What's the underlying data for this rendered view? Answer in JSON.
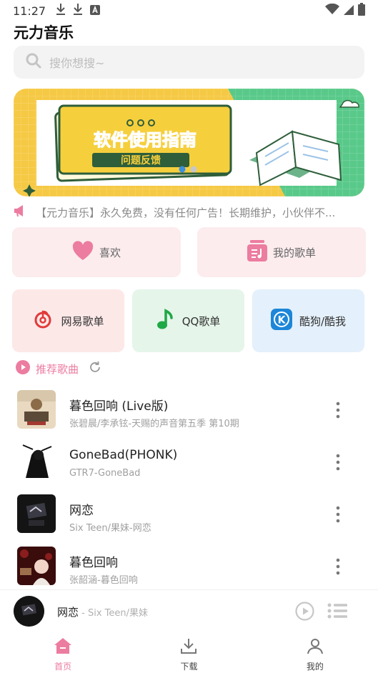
{
  "status": {
    "time": "11:27"
  },
  "app": {
    "title": "元力音乐"
  },
  "search": {
    "placeholder": "搜你想搜~"
  },
  "banner": {
    "title": "软件使用指南",
    "subtitle": "问题反馈",
    "active_dot": 0,
    "dot_count": 2
  },
  "notice": {
    "text": "【元力音乐】永久免费，没有任何广告！长期维护，小伙伴不..."
  },
  "quick": {
    "favorites": "喜欢",
    "playlists": "我的歌单"
  },
  "sources": [
    {
      "label": "网易歌单",
      "bg": "#fde8e8",
      "accent": "#e03a3a",
      "icon": "netease-icon"
    },
    {
      "label": "QQ歌单",
      "bg": "#e5f5ea",
      "accent": "#1fa846",
      "icon": "qq-music-icon"
    },
    {
      "label": "酷狗/酷我",
      "bg": "#e4f0fb",
      "accent": "#1d86d8",
      "icon": "kugou-icon"
    }
  ],
  "recommend": {
    "title": "推荐歌曲"
  },
  "songs": [
    {
      "name": "暮色回响 (Live版)",
      "sub": "张碧晨/李承铉-天赐的声音第五季 第10期"
    },
    {
      "name": "GoneBad(PHONK)",
      "sub": "GTR7-GoneBad"
    },
    {
      "name": "网恋",
      "sub": "Six Teen/果妹-网恋"
    },
    {
      "name": "暮色回响",
      "sub": "张韶涵-暮色回响"
    }
  ],
  "player": {
    "name": "网恋",
    "artist": " - Six Teen/果妹"
  },
  "tabs": [
    {
      "label": "首页",
      "active": true
    },
    {
      "label": "下载",
      "active": false
    },
    {
      "label": "我的",
      "active": false
    }
  ],
  "colors": {
    "accent": "#ec7ca0",
    "banner_green": "#59c98a",
    "banner_yellow": "#f6c945"
  }
}
